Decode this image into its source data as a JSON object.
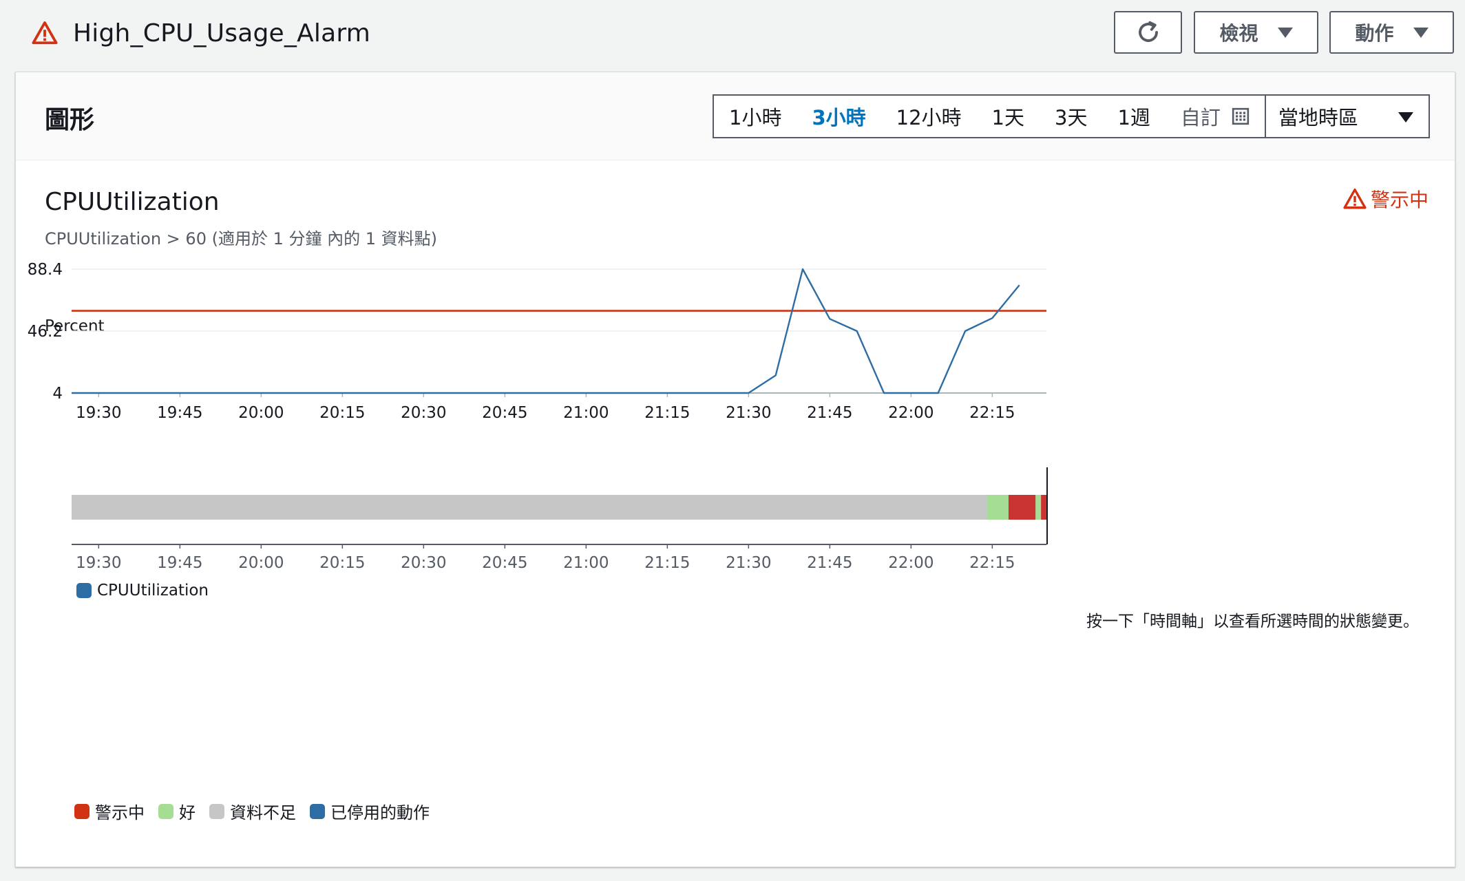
{
  "header": {
    "alarm_name": "High_CPU_Usage_Alarm",
    "refresh_icon": "refresh-icon",
    "view_label": "檢視",
    "actions_label": "動作"
  },
  "panel": {
    "title": "圖形",
    "time_ranges": [
      "1小時",
      "3小時",
      "12小時",
      "1天",
      "3天",
      "1週"
    ],
    "active_range": "3小時",
    "custom_label": "自訂",
    "timezone": "當地時區"
  },
  "metric": {
    "title": "CPUUtilization",
    "subtitle": "CPUUtilization > 60 (適用於 1 分鐘 內的 1 資料點)",
    "state_label": "警示中",
    "state_color": "#d13212"
  },
  "chart_data": {
    "type": "line",
    "ylabel": "Percent",
    "ylim": [
      4,
      88.4
    ],
    "y_ticks": [
      "88.4",
      "46.2",
      "4"
    ],
    "y_tick_values": [
      88.4,
      46.2,
      4
    ],
    "x_ticks": [
      "19:30",
      "19:45",
      "20:00",
      "20:15",
      "20:30",
      "20:45",
      "21:00",
      "21:15",
      "21:30",
      "21:45",
      "22:00",
      "22:15"
    ],
    "x_range": [
      "19:25",
      "22:25"
    ],
    "threshold": 60,
    "threshold_color": "#d13212",
    "series": [
      {
        "name": "CPUUtilization",
        "color": "#2e6da4",
        "x": [
          "19:25",
          "21:30",
          "21:35",
          "21:40",
          "21:45",
          "21:50",
          "21:55",
          "22:00",
          "22:05",
          "22:10",
          "22:15",
          "22:20"
        ],
        "values": [
          4,
          4,
          16,
          88.4,
          54.5,
          46.2,
          4,
          4,
          4,
          46.2,
          55,
          77.5
        ]
      }
    ],
    "legend": [
      "CPUUtilization"
    ]
  },
  "timeline": {
    "hint": "按一下「時間軸」以查看所選時間的狀態變更。",
    "segments": [
      {
        "state": "資料不足",
        "start": "19:25",
        "end": "22:14"
      },
      {
        "state": "好",
        "start": "22:14",
        "end": "22:18"
      },
      {
        "state": "警示中",
        "start": "22:18",
        "end": "22:23"
      },
      {
        "state": "好",
        "start": "22:23",
        "end": "22:24"
      },
      {
        "state": "警示中",
        "start": "22:24",
        "end": "22:25"
      }
    ],
    "x_ticks": [
      "19:30",
      "19:45",
      "20:00",
      "20:15",
      "20:30",
      "20:45",
      "21:00",
      "21:15",
      "21:30",
      "21:45",
      "22:00",
      "22:15"
    ],
    "legend": [
      {
        "label": "警示中",
        "color": "#d13212"
      },
      {
        "label": "好",
        "color": "#a6dd95"
      },
      {
        "label": "資料不足",
        "color": "#c6c6c6"
      },
      {
        "label": "已停用的動作",
        "color": "#2e6da4"
      }
    ],
    "colors": {
      "警示中": "#c93432",
      "好": "#a6dd95",
      "資料不足": "#c6c6c6"
    }
  }
}
